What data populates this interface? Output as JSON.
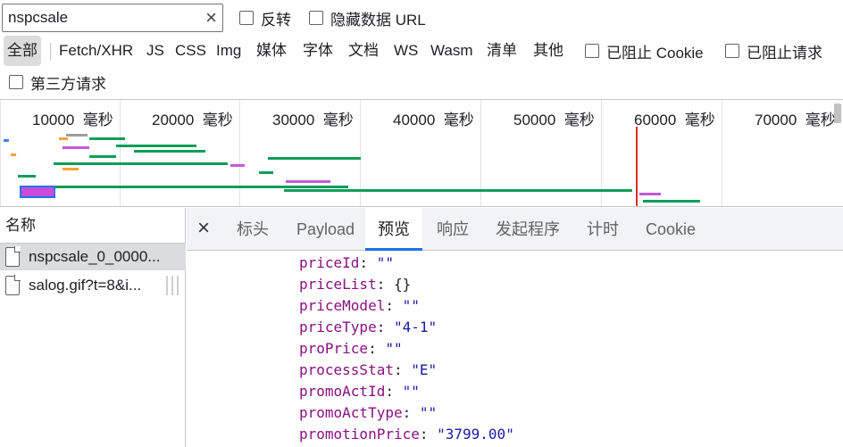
{
  "filter": {
    "value": "nspcsale",
    "clear_glyph": "×"
  },
  "checkboxes": {
    "invert": "反转",
    "hide_data_urls": "隐藏数据 URL",
    "blocked_cookies": "已阻止 Cookie",
    "blocked_requests": "已阻止请求",
    "third_party": "第三方请求"
  },
  "type_filters": [
    "全部",
    "Fetch/XHR",
    "JS",
    "CSS",
    "Img",
    "媒体",
    "字体",
    "文档",
    "WS",
    "Wasm",
    "清单",
    "其他"
  ],
  "timeline": {
    "unit": "毫秒",
    "ticks": [
      "10000",
      "20000",
      "30000",
      "40000",
      "50000",
      "60000",
      "70000"
    ]
  },
  "requests": {
    "header": "名称",
    "items": [
      {
        "name": "nspcsale_0_0000...",
        "selected": true
      },
      {
        "name": "salog.gif?t=8&i...",
        "selected": false
      }
    ]
  },
  "detail": {
    "close_glyph": "×",
    "tabs": [
      "标头",
      "Payload",
      "预览",
      "响应",
      "发起程序",
      "计时",
      "Cookie"
    ],
    "active_tab": "预览"
  },
  "preview": [
    {
      "key": "priceId",
      "value": "\"\""
    },
    {
      "key": "priceList",
      "value": "{}"
    },
    {
      "key": "priceModel",
      "value": "\"\""
    },
    {
      "key": "priceType",
      "value": "\"4-1\""
    },
    {
      "key": "proPrice",
      "value": "\"\""
    },
    {
      "key": "processStat",
      "value": "\"E\""
    },
    {
      "key": "promoActId",
      "value": "\"\""
    },
    {
      "key": "promoActType",
      "value": "\"\""
    },
    {
      "key": "promotionPrice",
      "value": "\"3799.00\""
    }
  ],
  "colors": {
    "accent": "#1a73e8",
    "marker": "#d93025",
    "json_key": "#881280",
    "json_string": "#1a1aa6"
  }
}
